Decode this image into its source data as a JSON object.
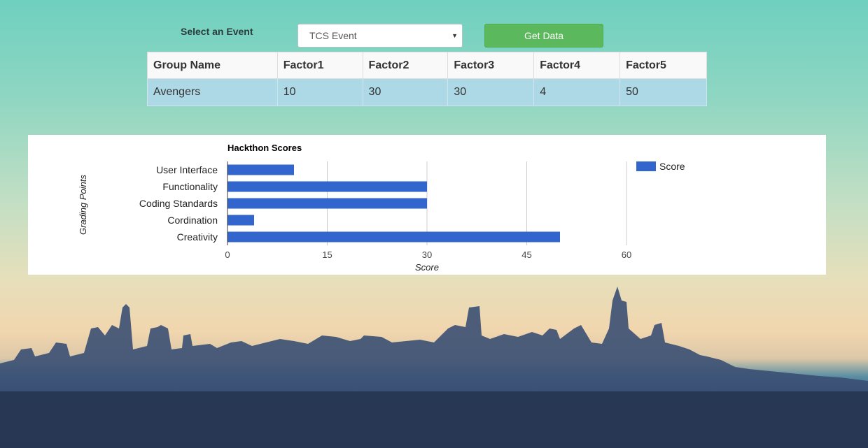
{
  "controls": {
    "event_label": "Select an Event",
    "event_select_value": "TCS Event",
    "get_data_label": "Get Data"
  },
  "table": {
    "headers": [
      "Group Name",
      "Factor1",
      "Factor2",
      "Factor3",
      "Factor4",
      "Factor5"
    ],
    "rows": [
      [
        "Avengers",
        "10",
        "30",
        "30",
        "4",
        "50"
      ]
    ]
  },
  "chart_data": {
    "type": "bar",
    "orientation": "horizontal",
    "title": "Hackthon Scores",
    "xlabel": "Score",
    "ylabel": "Grading Points",
    "categories": [
      "User Interface",
      "Functionality",
      "Coding Standards",
      "Cordination",
      "Creativity"
    ],
    "series": [
      {
        "name": "Score",
        "values": [
          10,
          30,
          30,
          4,
          50
        ],
        "color": "#3366cc"
      }
    ],
    "xlim": [
      0,
      60
    ],
    "xticks": [
      0,
      15,
      30,
      45,
      60
    ],
    "grid": true,
    "legend": "right"
  },
  "colors": {
    "button": "#5cb85c",
    "table_row": "#add8e6",
    "bar": "#3366cc"
  }
}
